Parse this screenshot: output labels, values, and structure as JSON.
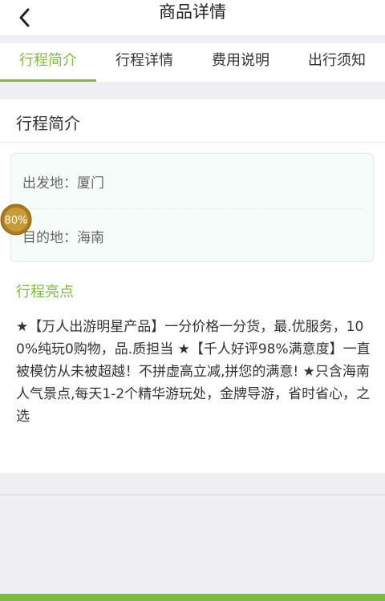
{
  "header": {
    "title": "商品详情"
  },
  "tabs": [
    {
      "label": "行程简介"
    },
    {
      "label": "行程详情"
    },
    {
      "label": "费用说明"
    },
    {
      "label": "出行须知"
    }
  ],
  "overview": {
    "section_title": "行程简介",
    "departure": "出发地：厦门",
    "destination": "目的地：海南",
    "highlights_title": "行程亮点",
    "highlights_text": "★【万人出游明星产品】一分价格一分货，最.优服务，100%纯玩0购物，品.质担当 ★【千人好评98%满意度】一直被模仿从未被超越！不拼虚高立减,拼您的满意! ★只含海南人气景点,每天1-2个精华游玩处，金牌导游，省时省心，之选"
  },
  "badge": {
    "label": "80%"
  },
  "colors": {
    "accent": "#7dbb3a",
    "background": "#efeff4",
    "badge": "#b07a1a"
  }
}
